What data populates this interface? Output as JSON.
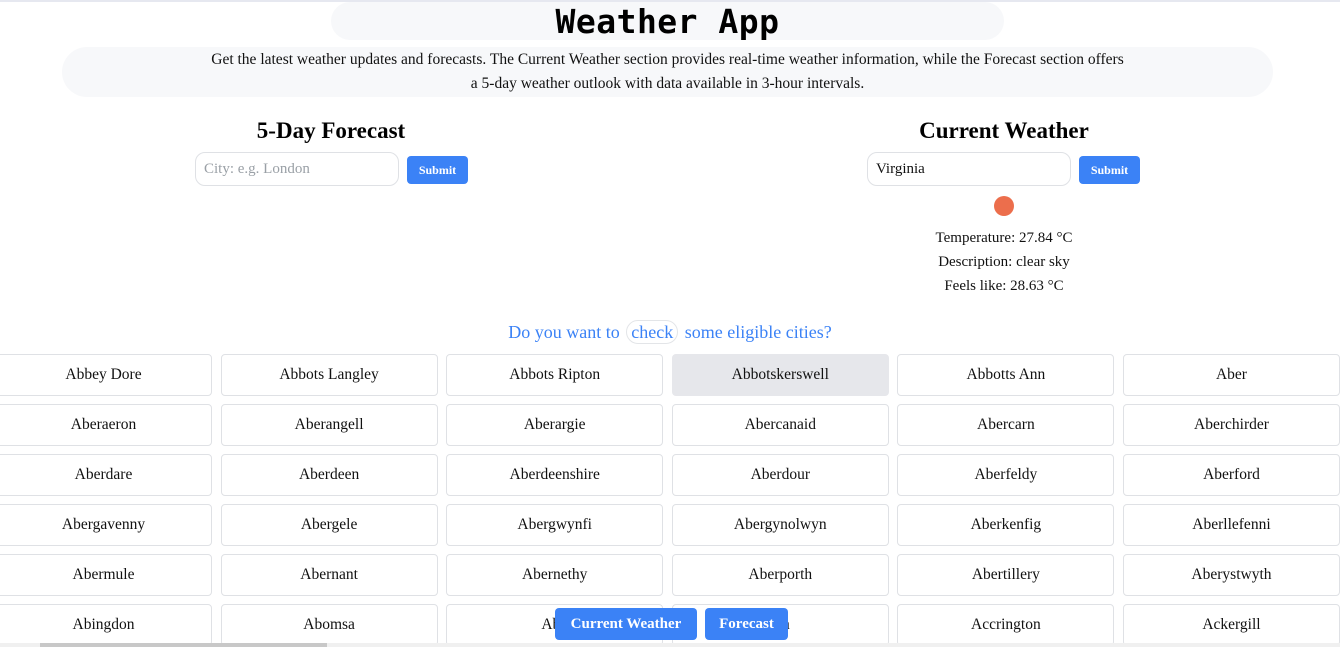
{
  "header": {
    "title": "Weather App",
    "description": "Get the latest weather updates and forecasts. The Current Weather section provides real-time weather information, while the Forecast section offers a 5-day weather outlook with data available in 3-hour intervals."
  },
  "forecast": {
    "title": "5-Day Forecast",
    "input_placeholder": "City: e.g. London",
    "input_value": "",
    "submit_label": "Submit"
  },
  "current": {
    "title": "Current Weather",
    "input_value": "Virginia",
    "submit_label": "Submit",
    "icon": "sun-icon",
    "icon_color": "#ec6e4c",
    "temperature": "Temperature: 27.84 °C",
    "description": "Description: clear sky",
    "feels_like": "Feels like: 28.63 °C"
  },
  "eligible": {
    "prefix": "Do you want to",
    "link": "check",
    "suffix": "some eligible cities?"
  },
  "cities": [
    "Abbey Dore",
    "Abbots Langley",
    "Abbots Ripton",
    "Abbotskerswell",
    "Abbotts Ann",
    "Aber",
    "Aberaeron",
    "Aberangell",
    "Aberargie",
    "Abercanaid",
    "Abercarn",
    "Aberchirder",
    "Aberdare",
    "Aberdeen",
    "Aberdeenshire",
    "Aberdour",
    "Aberfeldy",
    "Aberford",
    "Abergavenny",
    "Abergele",
    "Abergwynfi",
    "Abergynolwyn",
    "Aberkenfig",
    "Aberllefenni",
    "Abermule",
    "Abernant",
    "Abernethy",
    "Aberporth",
    "Abertillery",
    "Aberystwyth",
    "Abingdon",
    "Abomsa",
    "Abo",
    "am",
    "Accrington",
    "Ackergill"
  ],
  "highlighted_city": "Abbotskerswell",
  "nav": {
    "current_label": "Current Weather",
    "forecast_label": "Forecast"
  },
  "colors": {
    "accent": "#3b82f6",
    "panel_bg": "#f7f8fa",
    "highlight_bg": "#e6e7eb"
  }
}
